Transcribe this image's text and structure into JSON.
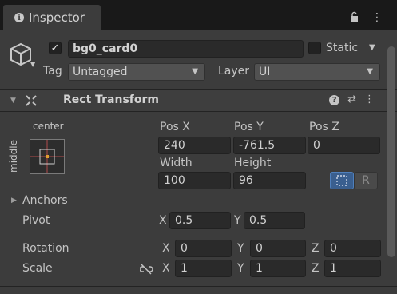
{
  "tab": {
    "title": "Inspector",
    "icon": "info-icon"
  },
  "header": {
    "object_name": "bg0_card0",
    "active": true,
    "static_label": "Static",
    "static_checked": false,
    "tag_label": "Tag",
    "tag_value": "Untagged",
    "layer_label": "Layer",
    "layer_value": "UI"
  },
  "component": {
    "title": "Rect Transform",
    "anchor_h": "center",
    "anchor_v": "middle",
    "pos_x_label": "Pos X",
    "pos_y_label": "Pos Y",
    "pos_z_label": "Pos Z",
    "pos_x": "240",
    "pos_y": "-761.5",
    "pos_z": "0",
    "width_label": "Width",
    "height_label": "Height",
    "width": "100",
    "height": "96",
    "raw_button": "R",
    "anchors_label": "Anchors",
    "pivot_label": "Pivot",
    "pivot_x": "0.5",
    "pivot_y": "0.5",
    "rotation_label": "Rotation",
    "rot_x": "0",
    "rot_y": "0",
    "rot_z": "0",
    "scale_label": "Scale",
    "scale_x": "1",
    "scale_y": "1",
    "scale_z": "1",
    "axis_x": "X",
    "axis_y": "Y",
    "axis_z": "Z"
  },
  "colors": {
    "accent": "#3a5f8f",
    "panel": "#3c3c3c"
  }
}
